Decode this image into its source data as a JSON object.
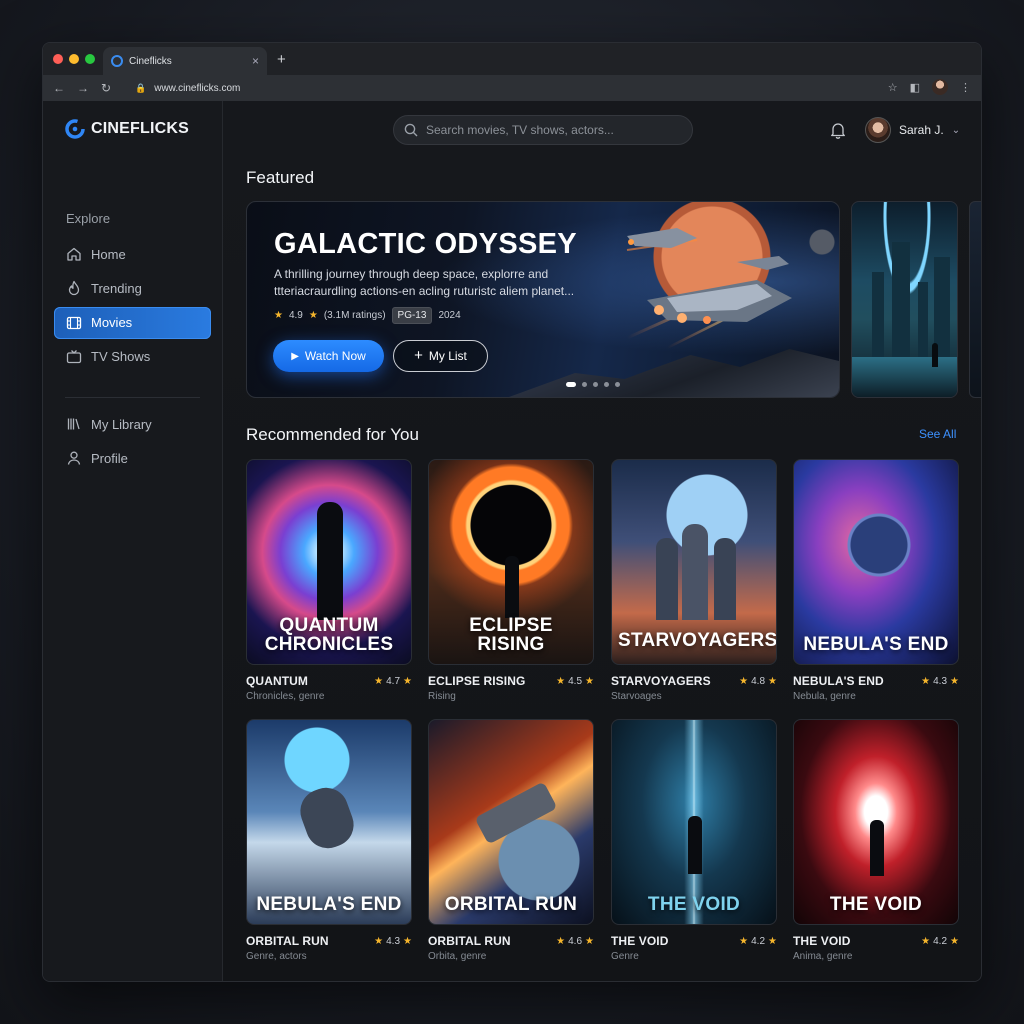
{
  "browser": {
    "tab_title": "Cineflicks",
    "url": "www.cineflicks.com"
  },
  "app": {
    "brand": "CINEFLICKS",
    "accent_color": "#2a7be0"
  },
  "sidebar": {
    "section_label": "Explore",
    "items": [
      {
        "label": "Home",
        "icon": "home-icon",
        "active": false
      },
      {
        "label": "Trending",
        "icon": "flame-icon",
        "active": false
      },
      {
        "label": "Movies",
        "icon": "film-icon",
        "active": true
      },
      {
        "label": "TV Shows",
        "icon": "tv-icon",
        "active": false
      }
    ],
    "secondary_items": [
      {
        "label": "My Library",
        "icon": "library-icon"
      },
      {
        "label": "Profile",
        "icon": "profile-icon"
      }
    ]
  },
  "header": {
    "search_placeholder": "Search movies, TV shows, actors...",
    "user_name": "Sarah J."
  },
  "featured": {
    "section_title": "Featured",
    "title": "GALACTIC ODYSSEY",
    "description": "A thrilling journey through deep space, explorre and ttteriacraurdling actions-en acling ruturistc aliem planet...",
    "rating": "4.9",
    "ratings_count": "(3.1M ratings)",
    "age_rating": "PG-13",
    "year": "2024",
    "watch_label": "Watch Now",
    "list_label": "My List",
    "carousel_position": 1,
    "carousel_total": 5
  },
  "recommended": {
    "section_title": "Recommended for You",
    "see_all": "See All",
    "cards": [
      {
        "poster_title": "QUANTUM CHRONICLES",
        "name": "QUANTUM",
        "rating": "4.7",
        "subtitle": "Chronicles, genre"
      },
      {
        "poster_title": "ECLIPSE RISING",
        "name": "ECLIPSE RISING",
        "rating": "4.5",
        "subtitle": "Rising"
      },
      {
        "poster_title": "STARVOYAGERS",
        "name": "STARVOYAGERS",
        "rating": "4.8",
        "subtitle": "Starvoages"
      },
      {
        "poster_title": "NEBULA'S END",
        "name": "NEBULA'S END",
        "rating": "4.3",
        "subtitle": "Nebula, genre"
      },
      {
        "poster_title": "NEBULA'S END",
        "name": "ORBITAL RUN",
        "rating": "4.3",
        "subtitle": "Genre, actors"
      },
      {
        "poster_title": "ORBITAL RUN",
        "name": "ORBITAL RUN",
        "rating": "4.6",
        "subtitle": "Orbita, genre"
      },
      {
        "poster_title": "THE VOID",
        "name": "THE VOID",
        "rating": "4.2",
        "subtitle": "Genre"
      },
      {
        "poster_title": "THE VOID",
        "name": "THE VOID",
        "rating": "4.2",
        "subtitle": "Anima, genre"
      }
    ]
  }
}
